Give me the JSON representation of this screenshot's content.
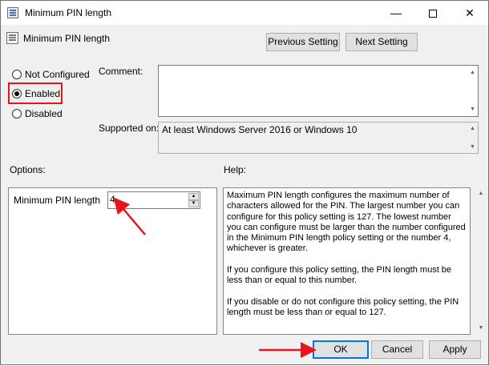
{
  "window": {
    "title": "Minimum PIN length",
    "minimize_glyph": "—",
    "close_glyph": "✕"
  },
  "header": {
    "policy_name": "Minimum PIN length",
    "previous_label": "Previous Setting",
    "next_label": "Next Setting"
  },
  "state": {
    "options": [
      "Not Configured",
      "Enabled",
      "Disabled"
    ],
    "selected": "Enabled"
  },
  "comment": {
    "label": "Comment:",
    "value": ""
  },
  "supported": {
    "label": "Supported on:",
    "value": "At least Windows Server 2016 or Windows 10"
  },
  "options_section": {
    "label": "Options:",
    "field_label": "Minimum PIN length",
    "field_value": "4"
  },
  "help_section": {
    "label": "Help:",
    "paragraphs": [
      "Maximum PIN length configures the maximum number of characters allowed for the PIN.  The largest number you can configure for this policy setting is 127. The lowest number you can configure must be larger than the number configured in the Minimum PIN length policy setting or the number 4, whichever is greater.",
      "If you configure this policy setting, the PIN length must be less than or equal to this number.",
      "If you disable or do not configure this policy setting, the PIN length must be less than or equal to 127."
    ]
  },
  "footer": {
    "ok_label": "OK",
    "cancel_label": "Cancel",
    "apply_label": "Apply"
  },
  "colors": {
    "annotation_red": "#e8131b",
    "focus_blue": "#0078d7"
  }
}
